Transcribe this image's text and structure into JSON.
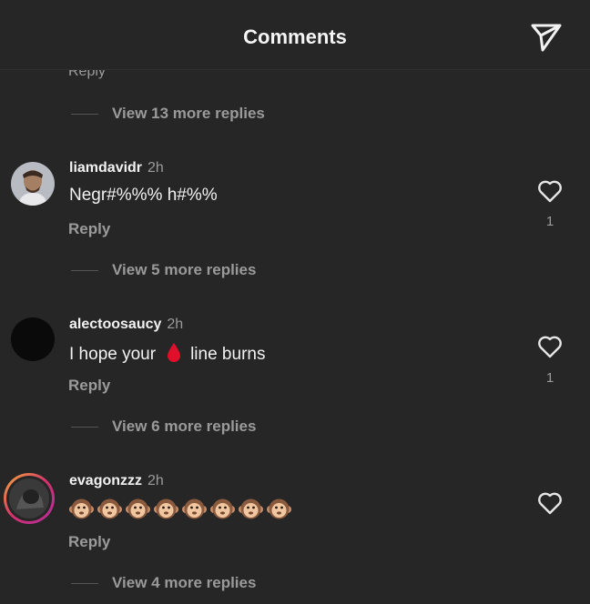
{
  "header": {
    "title": "Comments"
  },
  "top": {
    "reply_label": "Reply",
    "view_more_label": "View 13 more replies"
  },
  "comments": [
    {
      "username": "liamdavidr",
      "time": "2h",
      "text": "Negr#%%% h#%%",
      "reply_label": "Reply",
      "likes": "1",
      "view_more_label": "View 5 more replies"
    },
    {
      "username": "alectoosaucy",
      "time": "2h",
      "text_before": "I hope your",
      "text_after": "line burns",
      "inline_icon": "blood-drop-icon",
      "reply_label": "Reply",
      "likes": "1",
      "view_more_label": "View 6 more replies"
    },
    {
      "username": "evagonzzz",
      "time": "2h",
      "emoji": "monkey-face-icon",
      "emoji_count": 8,
      "reply_label": "Reply",
      "view_more_label": "View 4 more replies"
    }
  ],
  "colors": {
    "background": "#262626",
    "text_primary": "#f2f2f2",
    "text_secondary": "#9b9b9b",
    "story_ring": "#e0a030",
    "blood_drop": "#e0102a"
  }
}
